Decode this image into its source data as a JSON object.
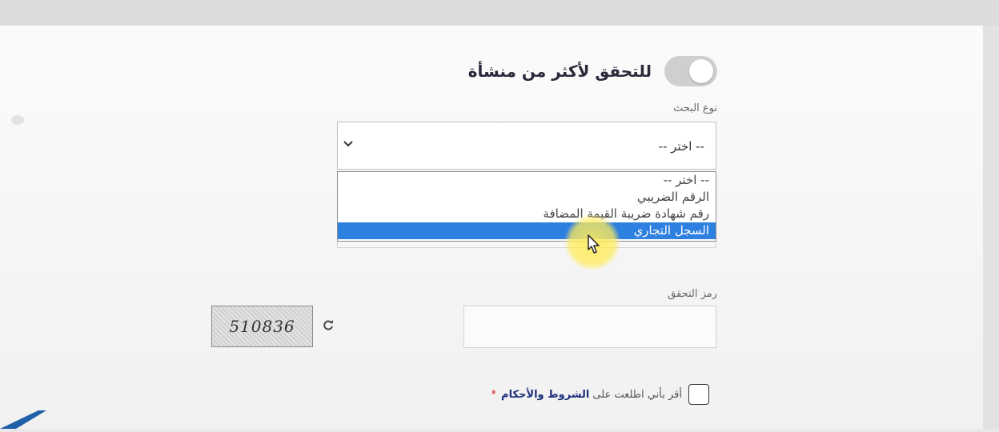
{
  "form": {
    "toggle_label": "للتحقق لأكثر من منشأة",
    "search_type_label": "نوع البحث",
    "select_value": "-- اختر --",
    "options": [
      "-- اختر --",
      "الرقم الضريبي",
      "رقم شهادة ضريبة القيمة المضافة",
      "السجل التجاري"
    ],
    "highlighted_option": "السجل التجاري",
    "verification_label": "رمز التحقق",
    "captcha_text": "510836",
    "terms_prefix": "أقر بأني اطلعت على",
    "terms_link": "الشروط والأحكام",
    "required_star": "*"
  },
  "icons": {
    "select_arrow": "chevron-down-icon",
    "refresh": "refresh-icon",
    "cursor": "mouse-pointer-icon"
  },
  "colors": {
    "selected_option_bg": "#2d7fe0",
    "terms_link": "#1d2f7a",
    "required_star": "#d8262e",
    "toggle_off": "#cfcfcf",
    "cursor_highlight": "#ffec5c"
  }
}
